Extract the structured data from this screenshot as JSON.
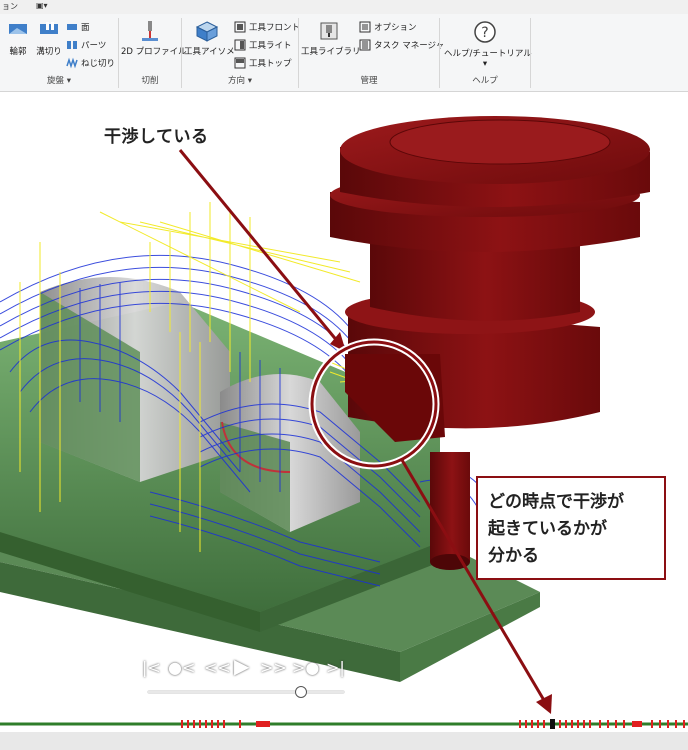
{
  "ribbon": {
    "tab_fragment": "ョン",
    "groups": [
      {
        "label": "旋盤",
        "big_buttons": [
          "輪郭",
          "溝切り"
        ],
        "small_buttons": [
          "面",
          "パーツ",
          "ねじ切り"
        ]
      },
      {
        "label": "切削",
        "big_buttons": [
          "2D プロファイル"
        ]
      },
      {
        "label": "方向",
        "big_buttons": [
          "工具アイソメ"
        ],
        "small_buttons": [
          "工具フロント",
          "工具ライト",
          "工具トップ"
        ]
      },
      {
        "label": "管理",
        "big_buttons": [
          "工具ライブラリ"
        ],
        "small_buttons": [
          "オプション",
          "タスク マネージャ"
        ]
      },
      {
        "label": "ヘルプ",
        "big_buttons": [
          "ヘルプ/チュートリアル"
        ]
      }
    ]
  },
  "viewport": {
    "callout_title": "干渉している",
    "callout_box_lines": [
      "どの時点で干渉が",
      "起きているかが",
      "分かる"
    ],
    "accent_color": "#8b0e12",
    "tool_color": "#7a0f10",
    "stock_color": "#6fa36a",
    "toolpath_blue": "#1a2fd8",
    "toolpath_yellow": "#f2ea2a"
  },
  "playback": {
    "buttons": [
      "to-start",
      "step-back-point",
      "rewind",
      "play",
      "fast-forward",
      "step-forward-point",
      "to-end"
    ],
    "progress": 0.78
  }
}
